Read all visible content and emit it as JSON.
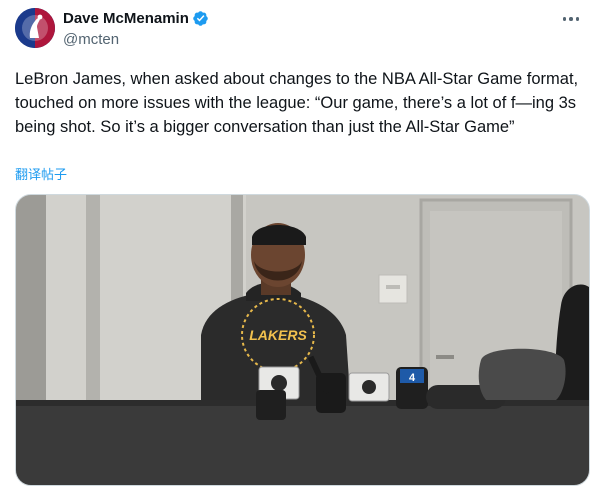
{
  "author": {
    "display_name": "Dave McMenamin",
    "handle": "@mcten",
    "avatar_icon": "nba-logo-icon",
    "verified": true,
    "verified_color": "#1d9bf0"
  },
  "tweet": {
    "text": "LeBron James, when asked about changes to the NBA All-Star Game format, touched on more issues with the league: “Our game, there’s a lot of f—ing 3s being shot. So it’s a bigger conversation than just the All-Star Game”",
    "translate_label": "翻译帖子"
  },
  "menu": {
    "icon": "more-options-icon"
  },
  "media": {
    "jersey_text": "LAKERS",
    "mic_flag_text": "4"
  },
  "colors": {
    "link": "#1d9bf0",
    "secondary_text": "#536471",
    "primary_text": "#0f1419"
  }
}
